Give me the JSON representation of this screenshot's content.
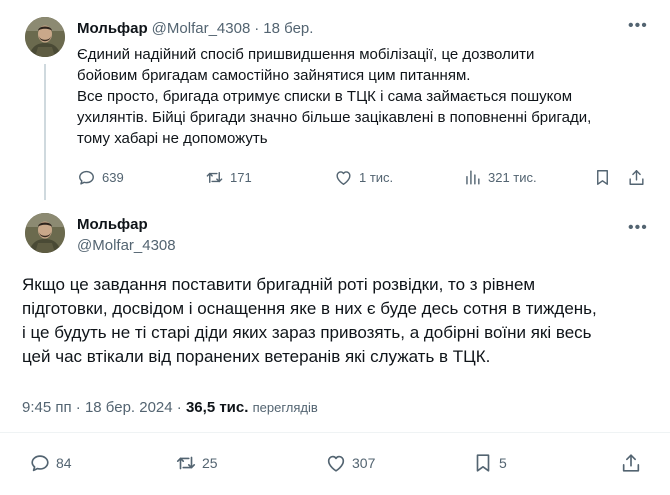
{
  "parent_post": {
    "author_name": "Мольфар",
    "author_handle": "@Molfar_4308",
    "separator": "·",
    "date": "18 бер.",
    "text_lines": [
      "Єдиний надійний спосіб пришвидшення мобілізації, це дозволити",
      "бойовим бригадам самостійно зайнятися цим питанням.",
      "Все просто, бригада отримує списки в ТЦК і сама займається пошуком",
      "ухилянтів. Бійці бригади значно більше зацікавлені в поповненні бригади,",
      "тому хабарі не допоможуть"
    ],
    "replies": "639",
    "reposts": "171",
    "likes": "1 тис.",
    "views": "321 тис."
  },
  "main_post": {
    "author_name": "Мольфар",
    "author_handle": "@Molfar_4308",
    "text_lines": [
      "Якщо це завдання поставити бригадній роті розвідки, то з рівнем",
      "підготовки, досвідом і оснащення яке в них є буде десь сотня в тиждень,",
      "і це будуть не ті старі діди яких зараз привозять, а добірні воїни які весь",
      "цей час втікали від поранених ветеранів які служать в ТЦК."
    ],
    "time": "9:45 пп",
    "separator": "·",
    "date": "18 бер. 2024",
    "separator2": "·",
    "views_count": "36,5 тис.",
    "views_label": "переглядів",
    "replies": "84",
    "reposts": "25",
    "likes": "307",
    "bookmarks": "5"
  },
  "colors": {
    "text": "#0f1419",
    "muted": "#536471",
    "border": "#eff3f4",
    "thread_line": "#cfd9de"
  },
  "icons": {
    "more": "more-horizontal-icon",
    "reply": "speech-bubble-icon",
    "repost": "repost-arrows-icon",
    "like": "heart-icon",
    "views": "bar-chart-icon",
    "bookmark": "bookmark-icon",
    "share": "share-upload-icon"
  }
}
